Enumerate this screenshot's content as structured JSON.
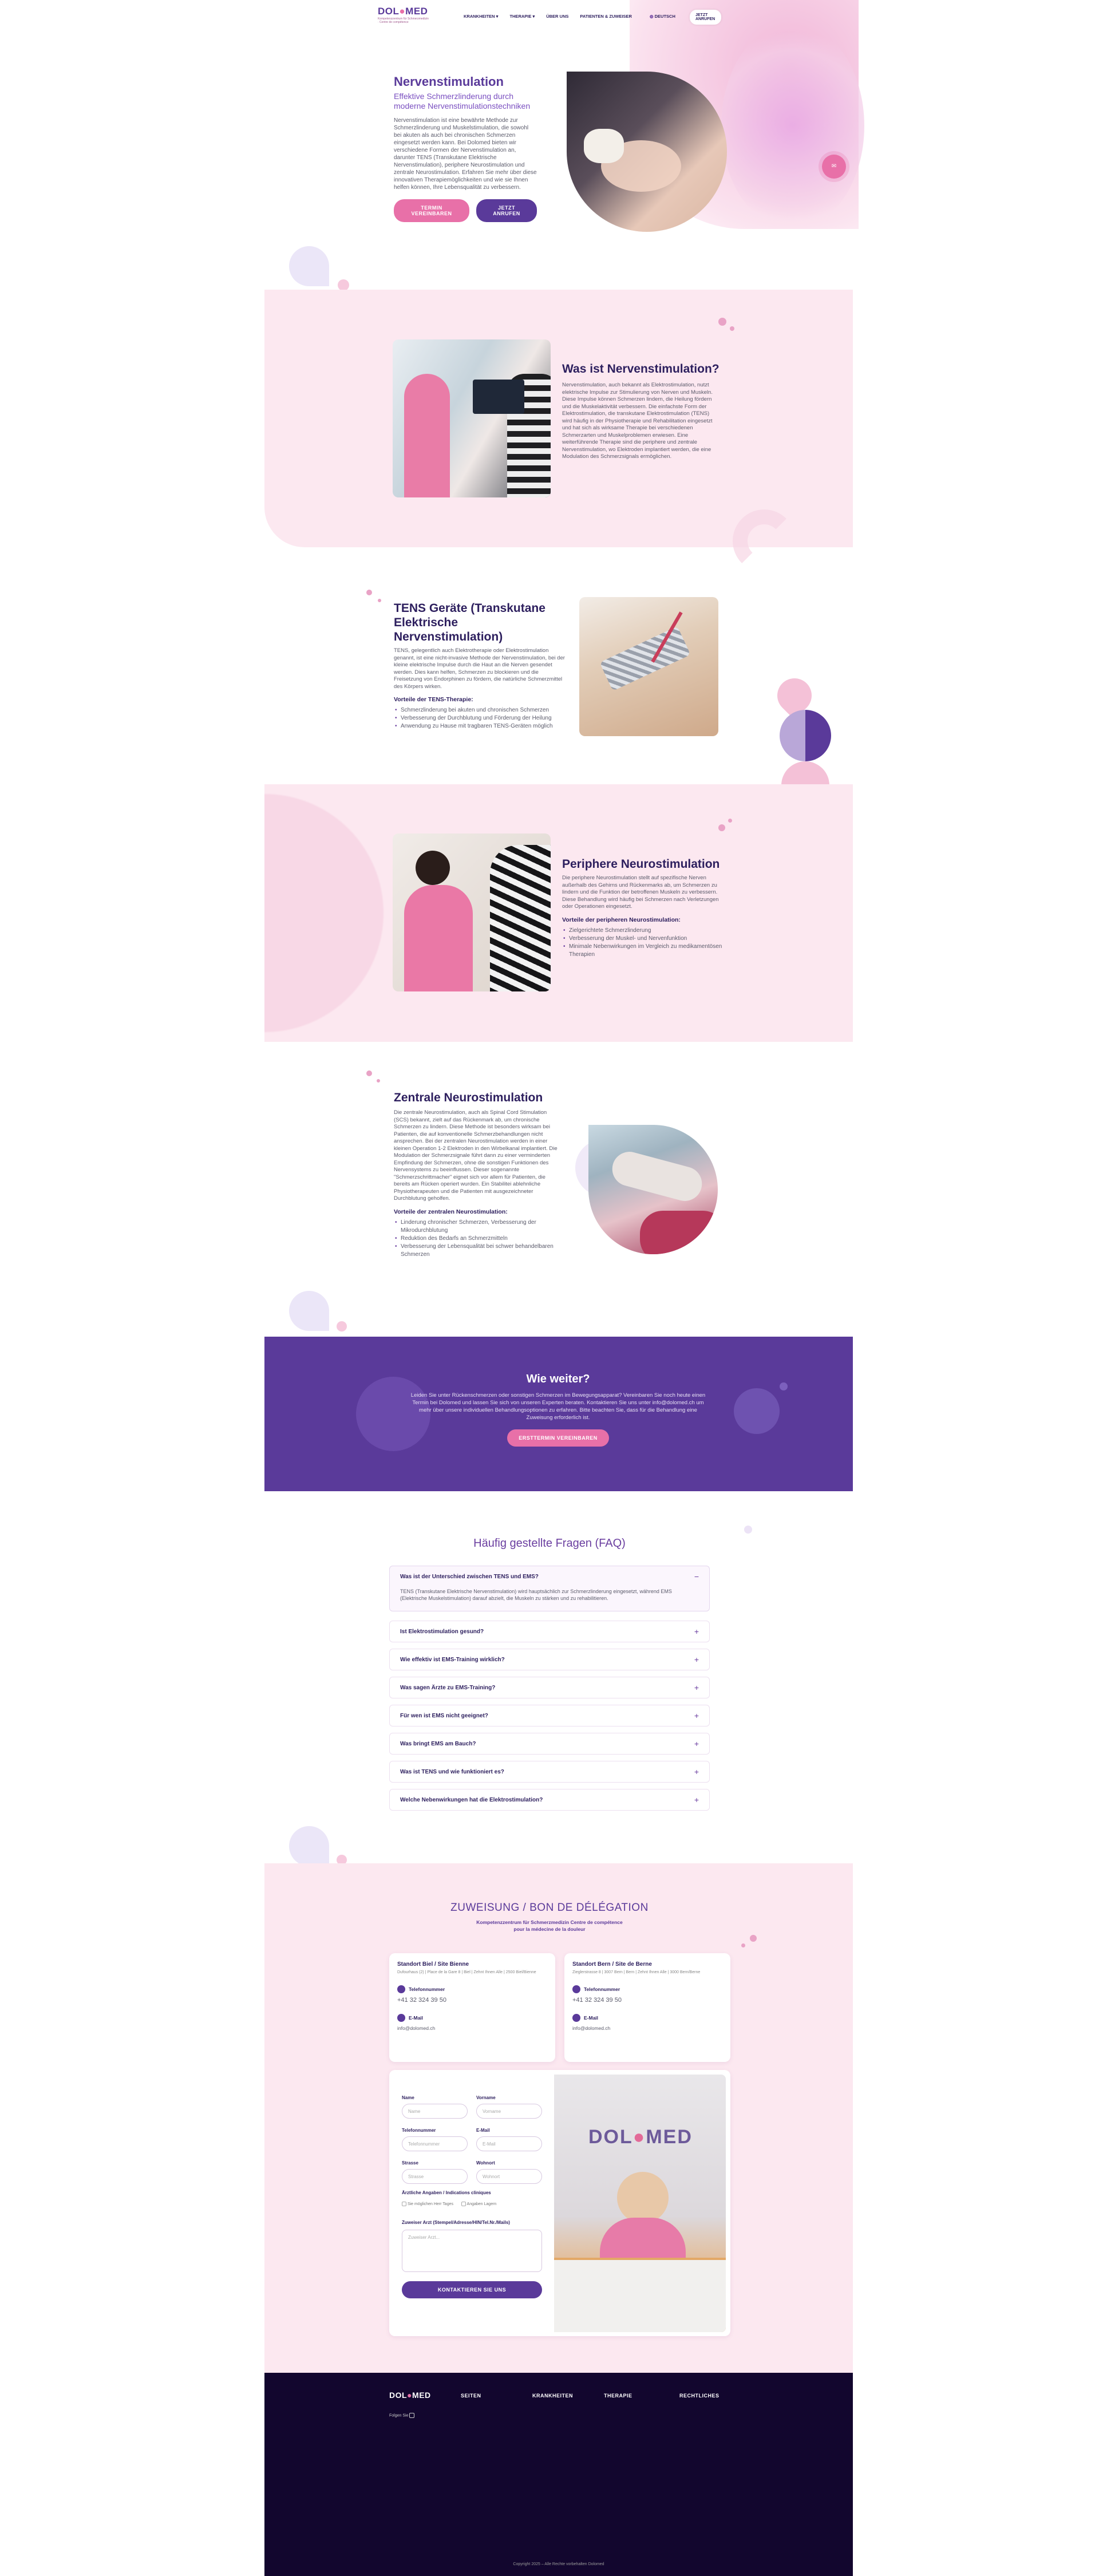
{
  "nav": {
    "logo": "DOLOMED",
    "logo_sub": "Kompetenzzentrum für Schmerzmedizin · Centre de compétence",
    "items": [
      "KRANKHEITEN ▾",
      "THERAPIE ▾",
      "ÜBER UNS",
      "PATIENTEN & ZUWEISER"
    ],
    "lang": "DEUTSCH",
    "cta": "JETZT ANRUFEN"
  },
  "hero": {
    "title": "Nervenstimulation",
    "subtitle": "Effektive Schmerzlinderung durch moderne Nervenstimulationstechniken",
    "body": "Nervenstimulation ist eine bewährte Methode zur Schmerzlinderung und Muskelstimulation, die sowohl bei akuten als auch bei chronischen Schmerzen eingesetzt werden kann. Bei Dolomed bieten wir verschiedene Formen der Nervenstimulation an, darunter TENS (Transkutane Elektrische Nervenstimulation), periphere Neurostimulation und zentrale Neurostimulation. Erfahren Sie mehr über diese innovativen Therapiemöglichkeiten und wie sie Ihnen helfen können, Ihre Lebensqualität zu verbessern.",
    "btn_primary": "TERMIN VEREINBAREN",
    "btn_secondary": "JETZT ANRUFEN"
  },
  "what": {
    "title": "Was ist Nervenstimulation?",
    "body": "Nervenstimulation, auch bekannt als Elektrostimulation, nutzt elektrische Impulse zur Stimulierung von Nerven und Muskeln. Diese Impulse können Schmerzen lindern, die Heilung fördern und die Muskelaktivität verbessern. Die einfachste Form der Elektrostimulation, die transkutane Elektrostimulation (TENS) wird häufig in der Physiotherapie und Rehabilitation eingesetzt und hat sich als wirksame Therapie bei verschiedenen Schmerzarten und Muskelproblemen erwiesen. Eine weiterführende Therapie sind die periphere und zentrale Nervenstimulation, wo Elektroden implantiert werden, die eine Modulation des Schmerzsignals ermöglichen."
  },
  "tens": {
    "title": "TENS Geräte (Transkutane Elektrische Nervenstimulation)",
    "body": "TENS, gelegentlich auch Elektrotherapie oder Elektrostimulation genannt, ist eine nicht-invasive Methode der Nervenstimulation, bei der kleine elektrische Impulse durch die Haut an die Nerven gesendet werden. Dies kann helfen, Schmerzen zu blockieren und die Freisetzung von Endorphinen zu fördern, die natürliche Schmerzmittel des Körpers wirken.",
    "benefits_title": "Vorteile der TENS-Therapie:",
    "benefits": [
      "Schmerzlinderung bei akuten und chronischen Schmerzen",
      "Verbesserung der Durchblutung und Förderung der Heilung",
      "Anwendung zu Hause mit tragbaren TENS-Geräten möglich"
    ]
  },
  "peripheral": {
    "title": "Periphere Neurostimulation",
    "body": "Die periphere Neurostimulation stellt auf spezifische Nerven außerhalb des Gehirns und Rückenmarks ab, um Schmerzen zu lindern und die Funktion der betroffenen Muskeln zu verbessern. Diese Behandlung wird häufig bei Schmerzen nach Verletzungen oder Operationen eingesetzt.",
    "benefits_title": "Vorteile der peripheren Neurostimulation:",
    "benefits": [
      "Zielgerichtete Schmerzlinderung",
      "Verbesserung der Muskel- und Nervenfunktion",
      "Minimale Nebenwirkungen im Vergleich zu medikamentösen Therapien"
    ]
  },
  "central": {
    "title": "Zentrale Neurostimulation",
    "body": "Die zentrale Neurostimulation, auch als Spinal Cord Stimulation (SCS) bekannt, zielt auf das Rückenmark ab, um chronische Schmerzen zu lindern. Diese Methode ist besonders wirksam bei Patienten, die auf konventionelle Schmerzbehandlungen nicht ansprechen. Bei der zentralen Neurostimulation werden in einer kleinen Operation 1-2 Elektroden in den Wirbelkanal implantiert. Die Modulation der Schmerzsignale führt dann zu einer verminderten Empfindung der Schmerzen, ohne die sonstigen Funktionen des Nervensystems zu beeinflussen. Dieser sogenannte \"Schmerzschrittmacher\" eignet sich vor allem für Patienten, die bereits am Rücken operiert wurden. Ein Stabilitei ablehnliche Physiotherapeuten und die Patienten mit ausgezeichneter Durchblutung geholfen.",
    "benefits_title": "Vorteile der zentralen Neurostimulation:",
    "benefits": [
      "Linderung chronischer Schmerzen, Verbesserung der Mikrodurchblutung",
      "Reduktion des Bedarfs an Schmerzmitteln",
      "Verbesserung der Lebensqualität bei schwer behandelbaren Schmerzen"
    ]
  },
  "next": {
    "title": "Wie weiter?",
    "body": "Leiden Sie unter Rückenschmerzen oder sonstigen Schmerzen im Bewegungsapparat? Vereinbaren Sie noch heute einen Termin bei Dolomed und lassen Sie sich von unseren Experten beraten. Kontaktieren Sie uns unter info@dolomed.ch um mehr über unsere individuellen Behandlungsoptionen zu erfahren. Bitte beachten Sie, dass für die Behandlung eine Zuweisung erforderlich ist.",
    "btn": "ERSTTERMIN VEREINBAREN"
  },
  "faq": {
    "title": "Häufig gestellte Fragen (FAQ)",
    "open_question": "Was ist der Unterschied zwischen TENS und EMS?",
    "open_answer": "TENS (Transkutane Elektrische Nervenstimulation) wird hauptsächlich zur Schmerzlinderung eingesetzt, während EMS (Elektrische Muskelstimulation) darauf abzielt, die Muskeln zu stärken und zu rehabilitieren.",
    "items": [
      "Ist Elektrostimulation gesund?",
      "Wie effektiv ist EMS-Training wirklich?",
      "Was sagen Ärzte zu EMS-Training?",
      "Für wen ist EMS nicht geeignet?",
      "Was bringt EMS am Bauch?",
      "Was ist TENS und wie funktioniert es?",
      "Welche Nebenwirkungen hat die Elektrostimulation?"
    ]
  },
  "referral": {
    "title": "ZUWEISUNG / BON DE DÉLÉGATION",
    "subtitle": "Kompetenzzentrum für Schmerzmedizin Centre de compétence pour la médecine de la douleur",
    "biel": {
      "title": "Standort Biel / Site Bienne",
      "address": "Dufourhaus (2) | Place de la Gare 8 | Biel | Zehnt Ihnen Alle | 2500 Biel/Bienne",
      "phone_label": "Telefonnummer",
      "phone": "+41 32 324 39 50",
      "email_label": "E-Mail",
      "email": "info@dolomed.ch"
    },
    "bern": {
      "title": "Standort Bern / Site de Berne",
      "address": "Zieglerstrasse 8 | 3007 Bern | Bern | Zehnt Ihnen Alle | 3000 Bern/Berne",
      "phone_label": "Telefonnummer",
      "phone": "+41 32 324 39 50",
      "email_label": "E-Mail",
      "email": "info@dolomed.ch"
    },
    "form": {
      "name_label": "Name",
      "name_ph": "Name",
      "firstname_label": "Vorname",
      "firstname_ph": "Vorname",
      "phone_label": "Telefonnummer",
      "phone_ph": "Telefonnummer",
      "email_label": "E-Mail",
      "email_ph": "E-Mail",
      "street_label": "Strasse",
      "street_ph": "Strasse",
      "city_label": "Wohnort",
      "city_ph": "Wohnort",
      "medical_label": "Ärztliche Angaben / Indications cliniques",
      "check1": "Sie möglichen Herr Tages",
      "check2": "Angaben Lagern",
      "doctor_label": "Zuweiser Arzt (Stempel/Adresse/HIN/Tel.Nr./Mails)",
      "doctor_ph": "Zuweiser Arzt...",
      "submit": "KONTAKTIEREN SIE UNS"
    }
  },
  "footer": {
    "logo": "DOLOMED",
    "follow": "Folgen Sie",
    "cols": [
      "SEITEN",
      "KRANKHEITEN",
      "THERAPIE",
      "RECHTLICHES"
    ],
    "copyright": "Copyright 2025 – Alle Rechte vorbehalten Dolomed"
  },
  "colors": {
    "brand_purple": "#5a3a9a",
    "brand_pink": "#e870a8",
    "section_pink": "#fce8f0",
    "footer_dark": "#12062e"
  }
}
